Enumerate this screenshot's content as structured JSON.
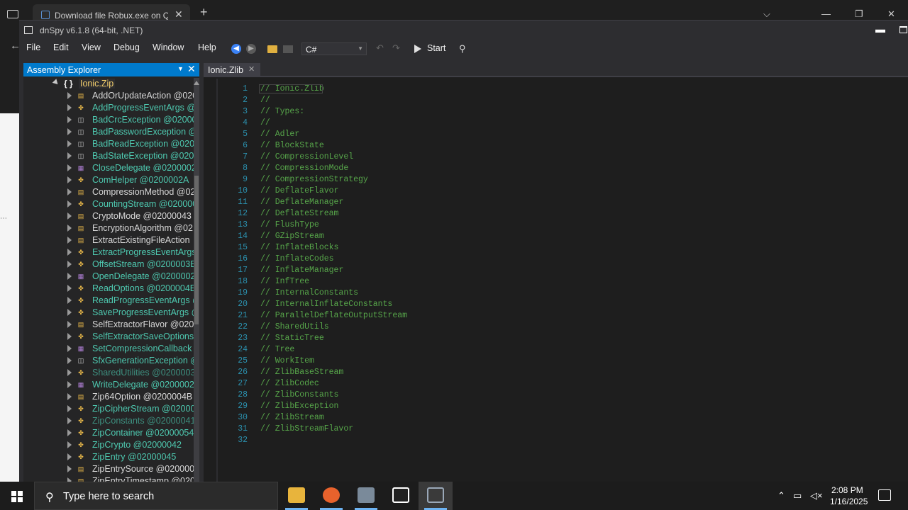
{
  "browser": {
    "tab_title": "Download file Robux.exe on Q",
    "tab_close": "✕",
    "new_tab": "+",
    "back": "←",
    "dots": "⋯"
  },
  "window": {
    "title": "dnSpy v6.1.8 (64-bit, .NET)"
  },
  "menu": {
    "items": [
      "File",
      "Edit",
      "View",
      "Debug",
      "Window",
      "Help"
    ]
  },
  "toolbar": {
    "language": "C#",
    "start_label": "Start"
  },
  "explorer": {
    "title": "Assembly Explorer",
    "root": {
      "icon": "{ }",
      "label": "Ionic.Zip"
    },
    "items": [
      {
        "label": "AddOrUpdateAction @020",
        "color": "#d8d8d8",
        "icon": "enum-icon"
      },
      {
        "label": "AddProgressEventArgs @",
        "color": "#4ec9b0",
        "icon": "class-icon"
      },
      {
        "label": "BadCrcException @02000",
        "color": "#4ec9b0",
        "icon": "exception-icon"
      },
      {
        "label": "BadPasswordException @",
        "color": "#4ec9b0",
        "icon": "exception-icon"
      },
      {
        "label": "BadReadException @0200",
        "color": "#4ec9b0",
        "icon": "exception-icon"
      },
      {
        "label": "BadStateException @0200",
        "color": "#4ec9b0",
        "icon": "exception-icon"
      },
      {
        "label": "CloseDelegate @0200002E",
        "color": "#4ec9b0",
        "icon": "delegate-icon"
      },
      {
        "label": "ComHelper @0200002A",
        "color": "#4ec9b0",
        "icon": "class-icon"
      },
      {
        "label": "CompressionMethod @02",
        "color": "#d8d8d8",
        "icon": "enum-icon"
      },
      {
        "label": "CountingStream @020000",
        "color": "#4ec9b0",
        "icon": "class-icon"
      },
      {
        "label": "CryptoMode @02000043",
        "color": "#d8d8d8",
        "icon": "enum-icon"
      },
      {
        "label": "EncryptionAlgorithm @02",
        "color": "#d8d8d8",
        "icon": "enum-icon"
      },
      {
        "label": "ExtractExistingFileAction",
        "color": "#d8d8d8",
        "icon": "enum-icon"
      },
      {
        "label": "ExtractProgressEventArgs",
        "color": "#4ec9b0",
        "icon": "class-icon"
      },
      {
        "label": "OffsetStream @0200003E",
        "color": "#4ec9b0",
        "icon": "class-icon"
      },
      {
        "label": "OpenDelegate @0200002D",
        "color": "#4ec9b0",
        "icon": "delegate-icon"
      },
      {
        "label": "ReadOptions @0200004E",
        "color": "#4ec9b0",
        "icon": "class-icon"
      },
      {
        "label": "ReadProgressEventArgs @",
        "color": "#4ec9b0",
        "icon": "class-icon"
      },
      {
        "label": "SaveProgressEventArgs @",
        "color": "#4ec9b0",
        "icon": "class-icon"
      },
      {
        "label": "SelfExtractorFlavor @0200",
        "color": "#d8d8d8",
        "icon": "enum-icon"
      },
      {
        "label": "SelfExtractorSaveOptions",
        "color": "#4ec9b0",
        "icon": "class-icon"
      },
      {
        "label": "SetCompressionCallback",
        "color": "#4ec9b0",
        "icon": "delegate-icon"
      },
      {
        "label": "SfxGenerationException @",
        "color": "#4ec9b0",
        "icon": "exception-icon"
      },
      {
        "label": "SharedUtilities @0200003F",
        "color": "#3d8f7f",
        "icon": "class-icon"
      },
      {
        "label": "WriteDelegate @0200002C",
        "color": "#4ec9b0",
        "icon": "delegate-icon"
      },
      {
        "label": "Zip64Option @0200004B",
        "color": "#d8d8d8",
        "icon": "enum-icon"
      },
      {
        "label": "ZipCipherStream @020000",
        "color": "#4ec9b0",
        "icon": "class-icon"
      },
      {
        "label": "ZipConstants @02000041",
        "color": "#3d8f7f",
        "icon": "class-icon"
      },
      {
        "label": "ZipContainer @02000054",
        "color": "#4ec9b0",
        "icon": "class-icon"
      },
      {
        "label": "ZipCrypto @02000042",
        "color": "#4ec9b0",
        "icon": "class-icon"
      },
      {
        "label": "ZipEntry @02000045",
        "color": "#4ec9b0",
        "icon": "class-icon"
      },
      {
        "label": "ZipEntrySource @0200004",
        "color": "#d8d8d8",
        "icon": "enum-icon"
      },
      {
        "label": "ZipEntryTimestamp @020",
        "color": "#d8d8d8",
        "icon": "enum-icon"
      }
    ]
  },
  "editor": {
    "tab_title": "Ionic.Zlib",
    "lines": [
      "// Ionic.Zlib",
      "//",
      "// Types:",
      "//",
      "// Adler",
      "// BlockState",
      "// CompressionLevel",
      "// CompressionMode",
      "// CompressionStrategy",
      "// DeflateFlavor",
      "// DeflateManager",
      "// DeflateStream",
      "// FlushType",
      "// GZipStream",
      "// InflateBlocks",
      "// InflateCodes",
      "// InflateManager",
      "// InfTree",
      "// InternalConstants",
      "// InternalInflateConstants",
      "// ParallelDeflateOutputStream",
      "// SharedUtils",
      "// StaticTree",
      "// Tree",
      "// WorkItem",
      "// ZlibBaseStream",
      "// ZlibCodec",
      "// ZlibConstants",
      "// ZlibException",
      "// ZlibStream",
      "// ZlibStreamFlavor",
      ""
    ]
  },
  "taskbar": {
    "search_placeholder": "Type here to search",
    "time": "2:08 PM",
    "date": "1/16/2025",
    "apps": [
      {
        "name": "file-explorer",
        "color": "#e8b43c"
      },
      {
        "name": "firefox",
        "color": "#e8622c"
      },
      {
        "name": "app-generic",
        "color": "#7a8a9a"
      },
      {
        "name": "7zip",
        "color": "#ffffff"
      },
      {
        "name": "task-view-active",
        "color": "#9aa8b8"
      }
    ]
  }
}
